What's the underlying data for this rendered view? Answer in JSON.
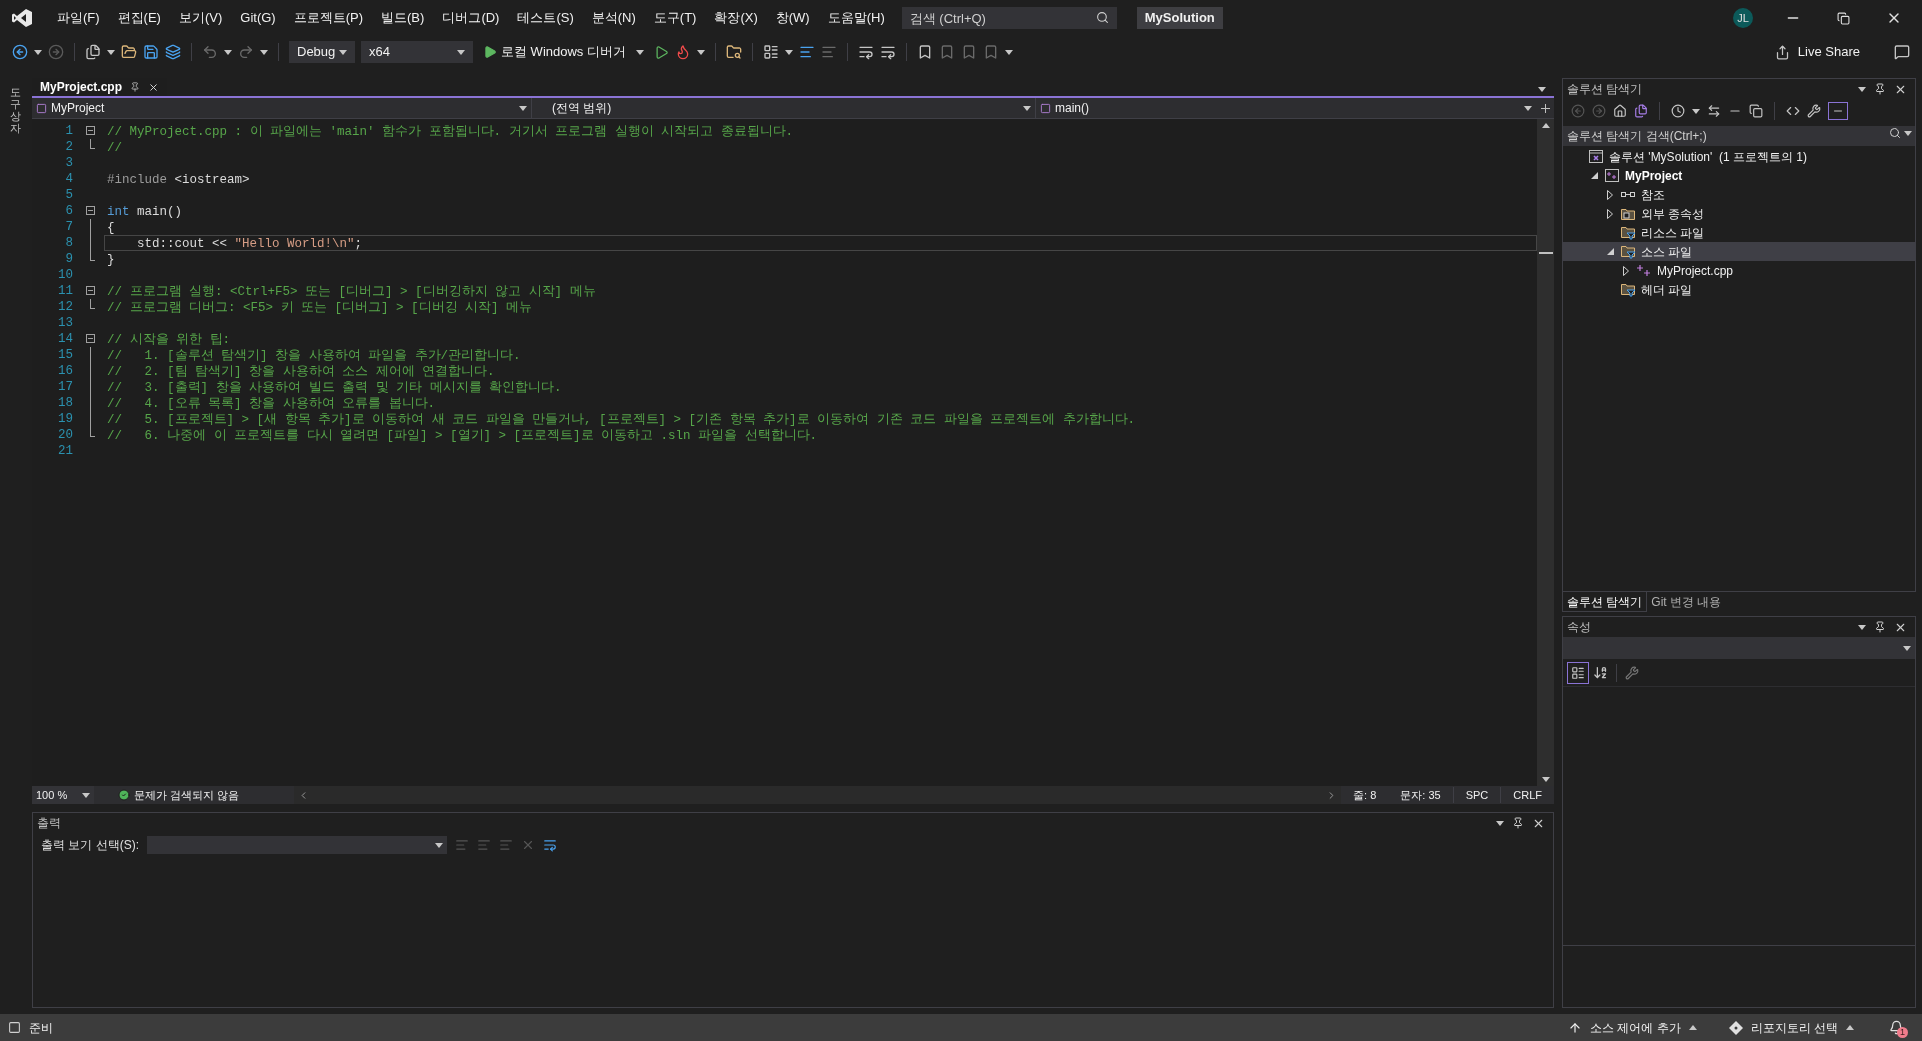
{
  "menu_bar": {
    "items": [
      "파일(F)",
      "편집(E)",
      "보기(V)",
      "Git(G)",
      "프로젝트(P)",
      "빌드(B)",
      "디버그(D)",
      "테스트(S)",
      "분석(N)",
      "도구(T)",
      "확장(X)",
      "창(W)",
      "도움말(H)"
    ],
    "search": {
      "placeholder": "검색 (Ctrl+Q)"
    },
    "solution_name": "MySolution",
    "avatar": "JL"
  },
  "toolbar": {
    "configuration": "Debug",
    "platform": "x64",
    "debugger": "로컬 Windows 디버거",
    "live_share": "Live Share"
  },
  "left_strip": {
    "label": "도구 상자"
  },
  "editor": {
    "tabs": [
      {
        "label": "MyProject.cpp",
        "selected": true
      }
    ],
    "nav": {
      "project": "MyProject",
      "scope": "(전역 범위)",
      "member": "main()"
    },
    "lines": [
      {
        "number": "1",
        "kind": "fold_start",
        "current": false,
        "tokens": [
          {
            "kind": "comment",
            "text": "// MyProject.cpp : 이 파일에는 'main' 함수가 포함됩니다. 거기서 프로그램 실행이 시작되고 종료됩니다."
          }
        ]
      },
      {
        "number": "2",
        "kind": "fold_end",
        "current": false,
        "tokens": [
          {
            "kind": "comment",
            "text": "//"
          }
        ]
      },
      {
        "number": "3",
        "kind": "plain",
        "current": false
      },
      {
        "number": "4",
        "kind": "plain",
        "current": false,
        "tokens": [
          {
            "kind": "preprocessor",
            "text": "#include"
          },
          {
            "kind": "plain",
            "text": " <iostream>"
          }
        ]
      },
      {
        "number": "5",
        "kind": "plain",
        "current": false
      },
      {
        "number": "6",
        "kind": "fold_start",
        "current": false,
        "tokens": [
          {
            "kind": "keyword",
            "text": "int"
          },
          {
            "kind": "plain",
            "text": " main()"
          }
        ]
      },
      {
        "number": "7",
        "kind": "fold_body",
        "current": false,
        "tokens": [
          {
            "kind": "plain",
            "text": "{"
          }
        ]
      },
      {
        "number": "8",
        "kind": "fold_body",
        "current": true,
        "tokens": [
          {
            "kind": "plain",
            "text": "    std::cout << "
          },
          {
            "kind": "string",
            "text": "\"Hello World!\\n\""
          },
          {
            "kind": "plain",
            "text": ";"
          }
        ]
      },
      {
        "number": "9",
        "kind": "fold_end",
        "current": false,
        "tokens": [
          {
            "kind": "plain",
            "text": "}"
          }
        ]
      },
      {
        "number": "10",
        "kind": "plain",
        "current": false
      },
      {
        "number": "11",
        "kind": "fold_start",
        "current": false,
        "tokens": [
          {
            "kind": "comment",
            "text": "// 프로그램 실행: <Ctrl+F5> 또는 [디버그] > [디버깅하지 않고 시작] 메뉴"
          }
        ]
      },
      {
        "number": "12",
        "kind": "fold_end",
        "current": false,
        "tokens": [
          {
            "kind": "comment",
            "text": "// 프로그램 디버그: <F5> 키 또는 [디버그] > [디버깅 시작] 메뉴"
          }
        ]
      },
      {
        "number": "13",
        "kind": "plain",
        "current": false
      },
      {
        "number": "14",
        "kind": "fold_start",
        "current": false,
        "tokens": [
          {
            "kind": "comment",
            "text": "// 시작을 위한 팁:"
          }
        ]
      },
      {
        "number": "15",
        "kind": "fold_body",
        "current": false,
        "tokens": [
          {
            "kind": "comment",
            "text": "//   1. [솔루션 탐색기] 창을 사용하여 파일을 추가/관리합니다."
          }
        ]
      },
      {
        "number": "16",
        "kind": "fold_body",
        "current": false,
        "tokens": [
          {
            "kind": "comment",
            "text": "//   2. [팀 탐색기] 창을 사용하여 소스 제어에 연결합니다."
          }
        ]
      },
      {
        "number": "17",
        "kind": "fold_body",
        "current": false,
        "tokens": [
          {
            "kind": "comment",
            "text": "//   3. [출력] 창을 사용하여 빌드 출력 및 기타 메시지를 확인합니다."
          }
        ]
      },
      {
        "number": "18",
        "kind": "fold_body",
        "current": false,
        "tokens": [
          {
            "kind": "comment",
            "text": "//   4. [오류 목록] 창을 사용하여 오류를 봅니다."
          }
        ]
      },
      {
        "number": "19",
        "kind": "fold_body",
        "current": false,
        "tokens": [
          {
            "kind": "comment",
            "text": "//   5. [프로젝트] > [새 항목 추가]로 이동하여 새 코드 파일을 만들거나, [프로젝트] > [기존 항목 추가]로 이동하여 기존 코드 파일을 프로젝트에 추가합니다."
          }
        ]
      },
      {
        "number": "20",
        "kind": "fold_end",
        "current": false,
        "tokens": [
          {
            "kind": "comment",
            "text": "//   6. 나중에 이 프로젝트를 다시 열려면 [파일] > [열기] > [프로젝트]로 이동하고 .sln 파일을 선택합니다."
          }
        ]
      },
      {
        "number": "21",
        "kind": "plain",
        "current": false
      }
    ],
    "status": {
      "zoom": "100 %",
      "issues": "문제가 검색되지 않음",
      "line": "줄: 8",
      "column": "문자: 35",
      "spacing": "SPC",
      "line_ending": "CRLF"
    }
  },
  "output": {
    "title": "출력",
    "source_label": "출력 보기 선택(S):"
  },
  "solution_explorer": {
    "title": "솔루션 탐색기",
    "search": {
      "placeholder": "솔루션 탐색기 검색(Ctrl+;)"
    },
    "tree": [
      {
        "label": "솔루션 'MySolution'  (1 프로젝트의 1)",
        "kind": "solution",
        "selected": false,
        "children": [
          {
            "label": "MyProject",
            "kind": "project",
            "expanded": true,
            "selected": false,
            "children": [
              {
                "label": "참조",
                "kind": "references",
                "expanded": false,
                "selected": false
              },
              {
                "label": "외부 종속성",
                "kind": "external",
                "expanded": false,
                "selected": false
              },
              {
                "label": "리소스 파일",
                "kind": "filter",
                "selected": false
              },
              {
                "label": "소스 파일",
                "kind": "filter",
                "expanded": true,
                "selected": true,
                "children": [
                  {
                    "label": "MyProject.cpp",
                    "kind": "cpp",
                    "expanded": false,
                    "selected": false
                  }
                ]
              },
              {
                "label": "헤더 파일",
                "kind": "filter",
                "selected": false
              }
            ]
          }
        ]
      }
    ],
    "tabs": [
      {
        "label": "솔루션 탐색기",
        "selected": true
      },
      {
        "label": "Git 변경 내용",
        "selected": false
      }
    ]
  },
  "properties": {
    "title": "속성"
  },
  "status_bar": {
    "ready": "준비",
    "source_control": "소스 제어에 추가",
    "repository": "리포지토리 선택",
    "notifications": "1"
  }
}
